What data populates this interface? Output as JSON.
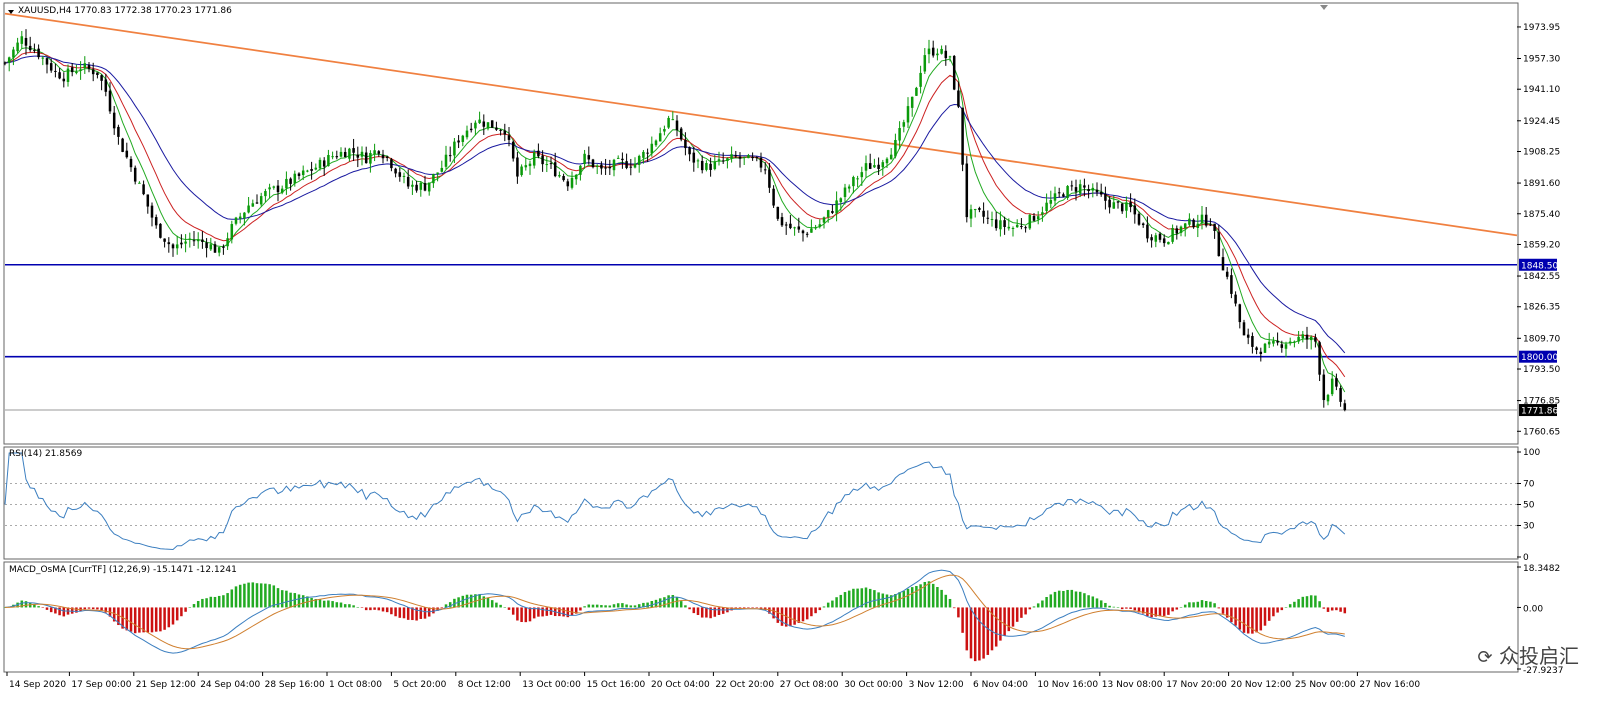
{
  "header": {
    "symbol_text": "XAUUSD,H4",
    "ohlc_text": "1770.83 1772.38 1770.23 1771.86"
  },
  "rsi_panel": {
    "label": "RSI(14) 21.8569"
  },
  "macd_panel": {
    "label": "MACD_OsMA [CurrTF] (12,26,9) -15.1471 -12.1241"
  },
  "watermark": {
    "text": "众投启汇"
  },
  "colors": {
    "bull": "#0a9a0a",
    "bear": "#000000",
    "ema_fast": "#22aa22",
    "ema_mid": "#cc2222",
    "ema_slow": "#1a1aa0",
    "trendline": "#f08040",
    "hline": "#0000b0",
    "rsi": "#3c7fc0",
    "macd_pos": "#22aa22",
    "macd_neg": "#cc1111",
    "macd_line1": "#3c7fc0",
    "macd_line2": "#d08030"
  },
  "chart_data": [
    {
      "type": "candlestick",
      "title": "XAUUSD,H4",
      "y_ticks": [
        "1973.95",
        "1957.30",
        "1941.10",
        "1924.45",
        "1908.25",
        "1891.60",
        "1875.40",
        "1859.20",
        "1842.55",
        "1826.35",
        "1809.70",
        "1793.50",
        "1776.85",
        "1760.65"
      ],
      "ylim": [
        1755,
        1985
      ],
      "x_tick_labels": [
        "14 Sep 2020",
        "17 Sep 00:00",
        "21 Sep 12:00",
        "24 Sep 04:00",
        "28 Sep 16:00",
        "1 Oct 08:00",
        "5 Oct 20:00",
        "8 Oct 12:00",
        "13 Oct 00:00",
        "15 Oct 16:00",
        "20 Oct 04:00",
        "22 Oct 20:00",
        "27 Oct 08:00",
        "30 Oct 00:00",
        "3 Nov 12:00",
        "6 Nov 04:00",
        "10 Nov 16:00",
        "13 Nov 08:00",
        "17 Nov 20:00",
        "20 Nov 12:00",
        "25 Nov 00:00",
        "27 Nov 16:00"
      ],
      "close_path": [
        [
          0,
          1955
        ],
        [
          4,
          1968
        ],
        [
          8,
          1960
        ],
        [
          12,
          1950
        ],
        [
          14,
          1948
        ],
        [
          18,
          1953
        ],
        [
          22,
          1950
        ],
        [
          24,
          1940
        ],
        [
          27,
          1915
        ],
        [
          30,
          1900
        ],
        [
          33,
          1885
        ],
        [
          36,
          1868
        ],
        [
          40,
          1857
        ],
        [
          44,
          1862
        ],
        [
          48,
          1860
        ],
        [
          51,
          1855
        ],
        [
          54,
          1868
        ],
        [
          58,
          1880
        ],
        [
          62,
          1886
        ],
        [
          66,
          1890
        ],
        [
          70,
          1895
        ],
        [
          74,
          1900
        ],
        [
          78,
          1906
        ],
        [
          82,
          1909
        ],
        [
          86,
          1905
        ],
        [
          89,
          1910
        ],
        [
          92,
          1902
        ],
        [
          96,
          1890
        ],
        [
          100,
          1890
        ],
        [
          104,
          1900
        ],
        [
          108,
          1915
        ],
        [
          112,
          1925
        ],
        [
          116,
          1922
        ],
        [
          119,
          1920
        ],
        [
          122,
          1895
        ],
        [
          126,
          1905
        ],
        [
          130,
          1900
        ],
        [
          134,
          1892
        ],
        [
          138,
          1905
        ],
        [
          142,
          1898
        ],
        [
          146,
          1902
        ],
        [
          150,
          1902
        ],
        [
          154,
          1912
        ],
        [
          158,
          1925
        ],
        [
          160,
          1920
        ],
        [
          163,
          1905
        ],
        [
          167,
          1900
        ],
        [
          170,
          1902
        ],
        [
          174,
          1905
        ],
        [
          178,
          1903
        ],
        [
          181,
          1900
        ],
        [
          184,
          1872
        ],
        [
          187,
          1868
        ],
        [
          190,
          1865
        ],
        [
          194,
          1870
        ],
        [
          197,
          1878
        ],
        [
          201,
          1890
        ],
        [
          205,
          1900
        ],
        [
          208,
          1902
        ],
        [
          212,
          1912
        ],
        [
          216,
          1935
        ],
        [
          219,
          1960
        ],
        [
          222,
          1962
        ],
        [
          225,
          1956
        ],
        [
          227,
          1930
        ],
        [
          229,
          1875
        ],
        [
          232,
          1875
        ],
        [
          236,
          1870
        ],
        [
          240,
          1868
        ],
        [
          244,
          1872
        ],
        [
          248,
          1880
        ],
        [
          252,
          1887
        ],
        [
          256,
          1890
        ],
        [
          260,
          1885
        ],
        [
          264,
          1880
        ],
        [
          268,
          1878
        ],
        [
          272,
          1865
        ],
        [
          276,
          1862
        ],
        [
          280,
          1868
        ],
        [
          284,
          1872
        ],
        [
          287,
          1872
        ],
        [
          289,
          1855
        ],
        [
          292,
          1835
        ],
        [
          295,
          1810
        ],
        [
          298,
          1804
        ],
        [
          301,
          1805
        ],
        [
          305,
          1808
        ],
        [
          309,
          1810
        ],
        [
          312,
          1808
        ],
        [
          314,
          1778
        ],
        [
          316,
          1786
        ],
        [
          319,
          1772
        ]
      ],
      "series": [
        {
          "name": "XAUUSD,H4",
          "type": "candlestick"
        }
      ],
      "horizontal_lines": [
        {
          "value": 1848.5,
          "label": "1848.50"
        },
        {
          "value": 1800.0,
          "label": "1800.00"
        },
        {
          "value": 1771.86,
          "label": "1771.86"
        }
      ],
      "trendline": [
        [
          0,
          1981
        ],
        [
          360,
          1864
        ]
      ],
      "x_range": [
        0,
        360
      ]
    },
    {
      "type": "line",
      "title": "RSI(14) 21.8569",
      "y_ticks": [
        "100",
        "70",
        "50",
        "30",
        "0"
      ],
      "ylim": [
        0,
        100
      ],
      "levels": [
        70,
        50,
        30
      ],
      "last_value": 21.8569
    },
    {
      "type": "bar",
      "title": "MACD_OsMA [CurrTF] (12,26,9) -15.1471 -12.1241",
      "y_ticks": [
        "18.3482",
        "0.00",
        "-27.9237"
      ],
      "ylim": [
        -27.9237,
        18.3482
      ],
      "last_values": [
        -15.1471,
        -12.1241
      ]
    }
  ]
}
